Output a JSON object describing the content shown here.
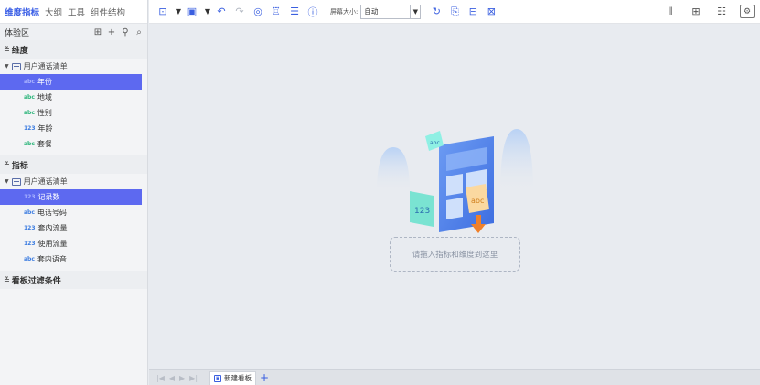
{
  "left_tabs": [
    "维度指标",
    "大纲",
    "工具",
    "组件结构"
  ],
  "panel_title": "体验区",
  "panel_tools": [
    "new-table-icon",
    "plus-icon",
    "link-icon",
    "search-icon"
  ],
  "dimension_section": {
    "title": "维度",
    "table_name": "用户通话清单",
    "items": [
      {
        "type": "abc",
        "label": "年份"
      },
      {
        "type": "abc",
        "label": "地域"
      },
      {
        "type": "abc",
        "label": "性别"
      },
      {
        "type": "123",
        "label": "年龄"
      },
      {
        "type": "abc",
        "label": "套餐"
      }
    ]
  },
  "metric_section": {
    "title": "指标",
    "table_name": "用户通话清单",
    "items": [
      {
        "type": "123",
        "label": "记录数"
      },
      {
        "type": "abc",
        "label": "电话号码"
      },
      {
        "type": "123",
        "label": "套内流量"
      },
      {
        "type": "123",
        "label": "使用流量"
      },
      {
        "type": "abc",
        "label": "套内语音"
      }
    ]
  },
  "filter_section": {
    "title": "看板过滤条件"
  },
  "toolbar": {
    "screen_size_label": "屏幕大小:",
    "screen_size_value": "自动"
  },
  "canvas": {
    "drop_hint": "请拖入指标和维度到这里",
    "illus_abc": "abc",
    "illus_num": "123"
  },
  "bottom": {
    "tab_label": "新建看板"
  },
  "colors": {
    "accent": "#3a5fe0",
    "selected": "#5d69f0"
  }
}
